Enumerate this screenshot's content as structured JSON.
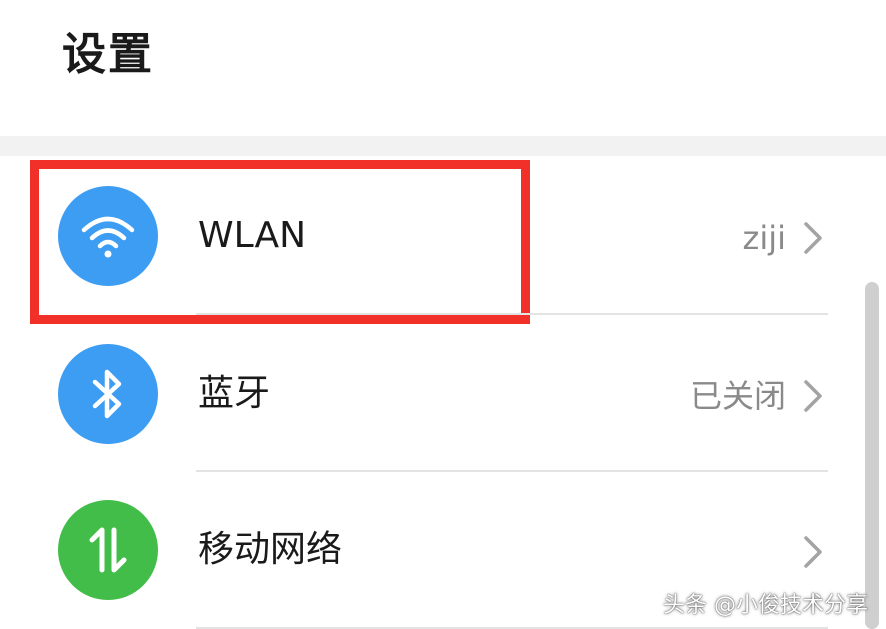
{
  "header": {
    "title": "设置"
  },
  "settings": {
    "items": [
      {
        "label": "WLAN",
        "value": "ziji",
        "icon": "wifi-icon",
        "icon_bg": "#3d9df2"
      },
      {
        "label": "蓝牙",
        "value": "已关闭",
        "icon": "bluetooth-icon",
        "icon_bg": "#3d9df2"
      },
      {
        "label": "移动网络",
        "value": "",
        "icon": "mobile-data-arrows-icon",
        "icon_bg": "#43bd4a"
      }
    ]
  },
  "annotation": {
    "highlight_color": "#f2302a"
  },
  "watermark": {
    "text": "头条 @小俊技术分享"
  }
}
